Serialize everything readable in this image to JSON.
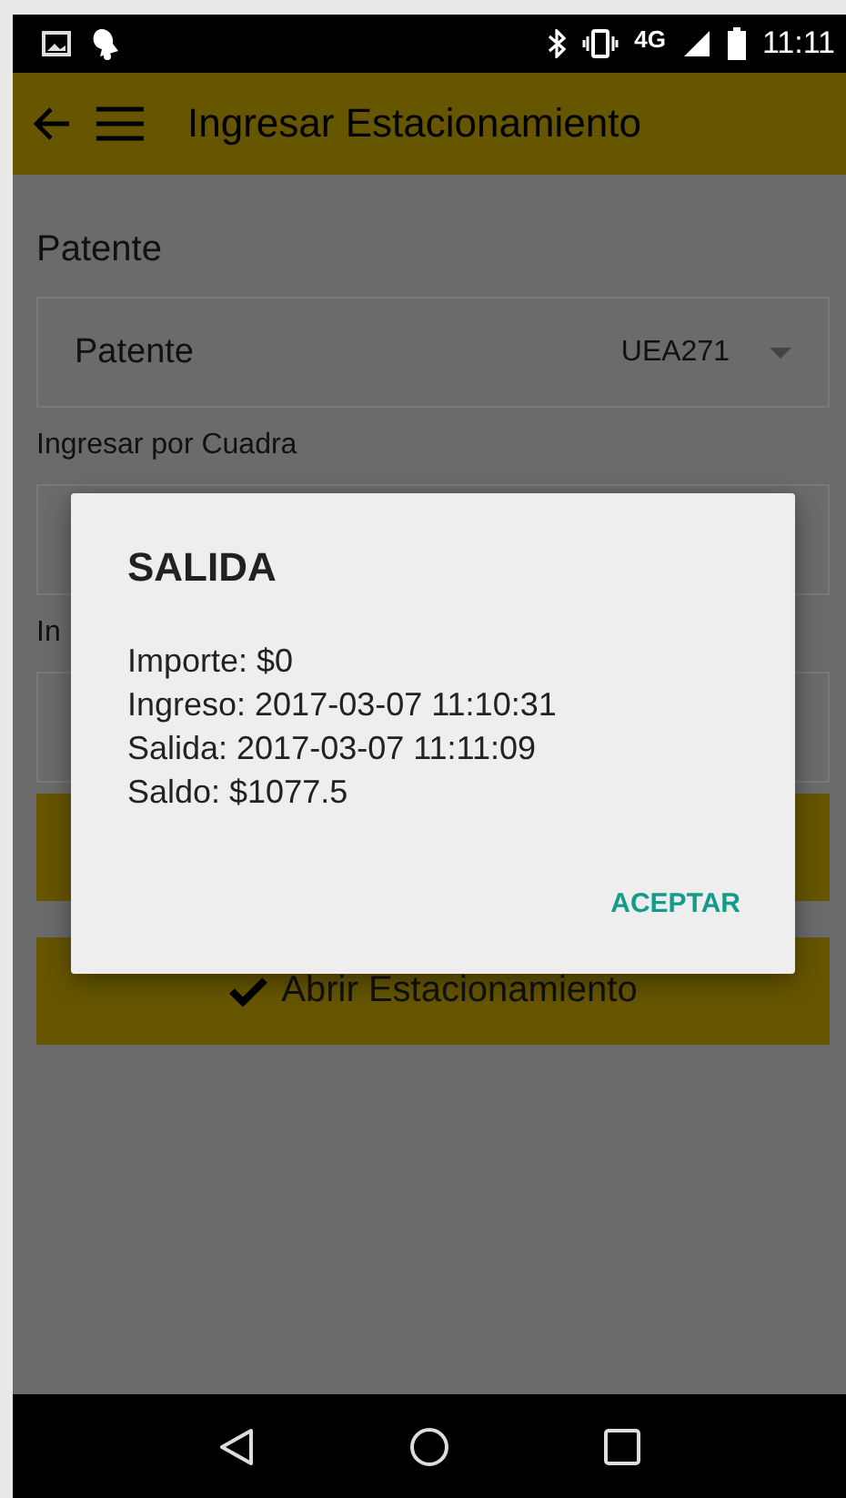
{
  "status_bar": {
    "network": "4G",
    "time": "11:11"
  },
  "app_bar": {
    "title": "Ingresar Estacionamiento"
  },
  "form": {
    "heading": "Patente",
    "patente_field": {
      "label": "Patente",
      "value": "UEA271"
    },
    "cuadra_label": "Ingresar por Cuadra",
    "partial_label": "In",
    "open_button": "Abrir Estacionamiento"
  },
  "dialog": {
    "title": "SALIDA",
    "lines": [
      "Importe: $0",
      "Ingreso: 2017-03-07 11:10:31",
      "Salida: 2017-03-07 11:11:09",
      "Saldo: $1077.5"
    ],
    "button": "ACEPTAR"
  }
}
